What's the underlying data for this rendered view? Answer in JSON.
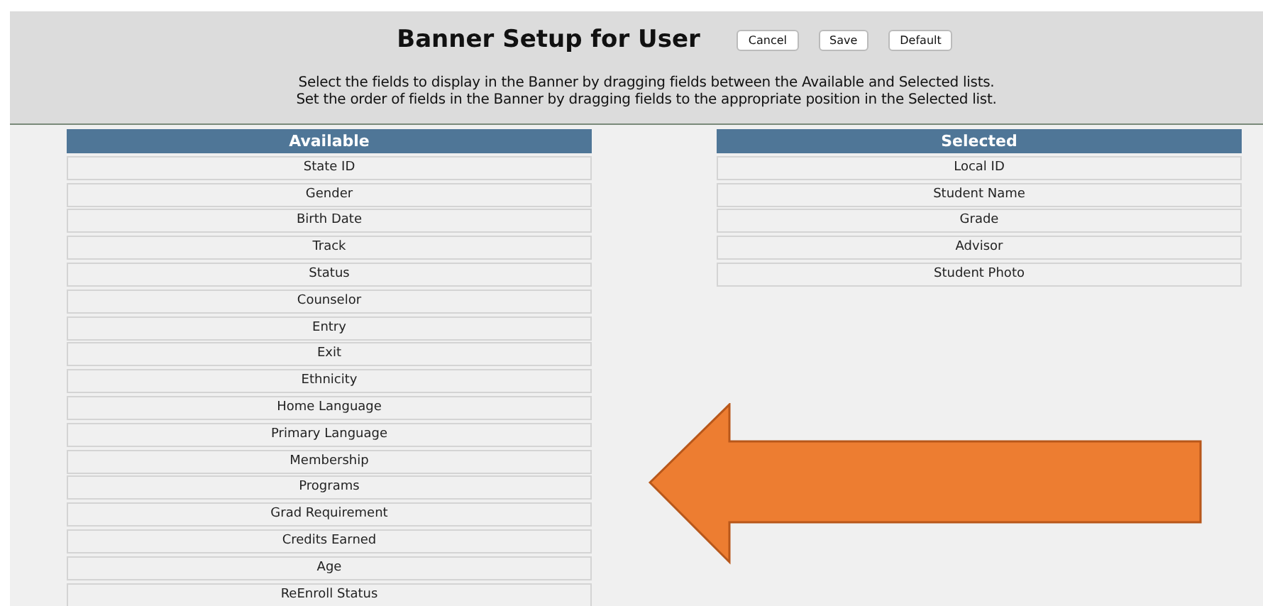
{
  "header": {
    "title": "Banner Setup for User",
    "buttons": [
      "Cancel",
      "Save",
      "Default"
    ],
    "instructions": [
      "Select the fields to display in the Banner by dragging fields between the Available and Selected lists.",
      "Set the order of fields in the Banner by dragging fields to the appropriate position in the Selected list."
    ]
  },
  "lists": [
    {
      "title": "Available",
      "items": [
        "State ID",
        "Gender",
        "Birth Date",
        "Track",
        "Status",
        "Counselor",
        "Entry",
        "Exit",
        "Ethnicity",
        "Home Language",
        "Primary Language",
        "Membership",
        "Programs",
        "Grad Requirement",
        "Credits Earned",
        "Age",
        "ReEnroll Status"
      ]
    },
    {
      "title": "Selected",
      "items": [
        "Local ID",
        "Student Name",
        "Grade",
        "Advisor",
        "Student Photo"
      ]
    }
  ]
}
